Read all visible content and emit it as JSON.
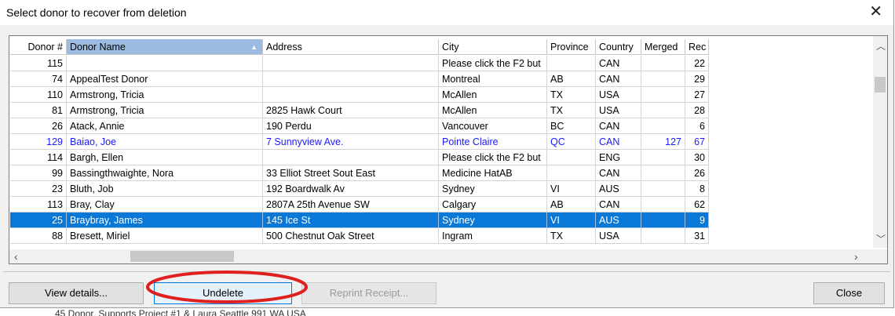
{
  "window": {
    "title": "Select donor to recover from deletion",
    "close_symbol": "✕"
  },
  "table": {
    "headers": [
      "Donor #",
      "Donor Name",
      "Address",
      "City",
      "Province",
      "Country",
      "Merged",
      "Rec"
    ],
    "sorted_column": "Donor Name",
    "rows": [
      [
        "115",
        "",
        "",
        "Please click the F2 but",
        "",
        "CAN",
        "",
        "22"
      ],
      [
        "74",
        "AppealTest Donor",
        "",
        "Montreal",
        "AB",
        "CAN",
        "",
        "29"
      ],
      [
        "110",
        "Armstrong, Tricia",
        "",
        "McAllen",
        "TX",
        "USA",
        "",
        "27"
      ],
      [
        "81",
        "Armstrong, Tricia",
        "2825 Hawk Court",
        "McAllen",
        "TX",
        "USA",
        "",
        "28"
      ],
      [
        "26",
        "Atack, Annie",
        "190 Perdu",
        "Vancouver",
        "BC",
        "CAN",
        "",
        "6"
      ],
      [
        "129",
        "Baiao, Joe",
        "7 Sunnyview Ave.",
        "Pointe Claire",
        "QC",
        "CAN",
        "127",
        "67"
      ],
      [
        "114",
        "Bargh, Ellen",
        "",
        "Please click the F2 but",
        "",
        "ENG",
        "",
        "30"
      ],
      [
        "99",
        "Bassingthwaighte, Nora",
        "33 Elliot Street Sout East",
        "Medicine HatAB",
        "",
        "CAN",
        "",
        "26"
      ],
      [
        "23",
        "Bluth, Job",
        "192 Boardwalk Av",
        "Sydney",
        "VI",
        "AUS",
        "",
        "8"
      ],
      [
        "113",
        "Bray, Clay",
        "2807A 25th Avenue SW",
        "Calgary",
        "AB",
        "CAN",
        "",
        "62"
      ],
      [
        "25",
        "Braybray, James",
        "145 Ice St",
        "Sydney",
        "VI",
        "AUS",
        "",
        "9"
      ],
      [
        "88",
        "Bresett, Miriel",
        "500 Chestnut Oak Street",
        "Ingram",
        "TX",
        "USA",
        "",
        "31"
      ]
    ],
    "highlighted_row_index": 5,
    "selected_row_index": 10
  },
  "buttons": {
    "view_details": "View details...",
    "undelete": "Undelete",
    "reprint_receipt": "Reprint Receipt...",
    "close": "Close"
  },
  "colors": {
    "selection": "#0a78d7",
    "merged_row_text": "#1a1aff",
    "annotation_ellipse": "#e0201e"
  },
  "background_window_text": "45  Donor, Supports Project #1 & Laura     Seattle                    991           WA           USA"
}
